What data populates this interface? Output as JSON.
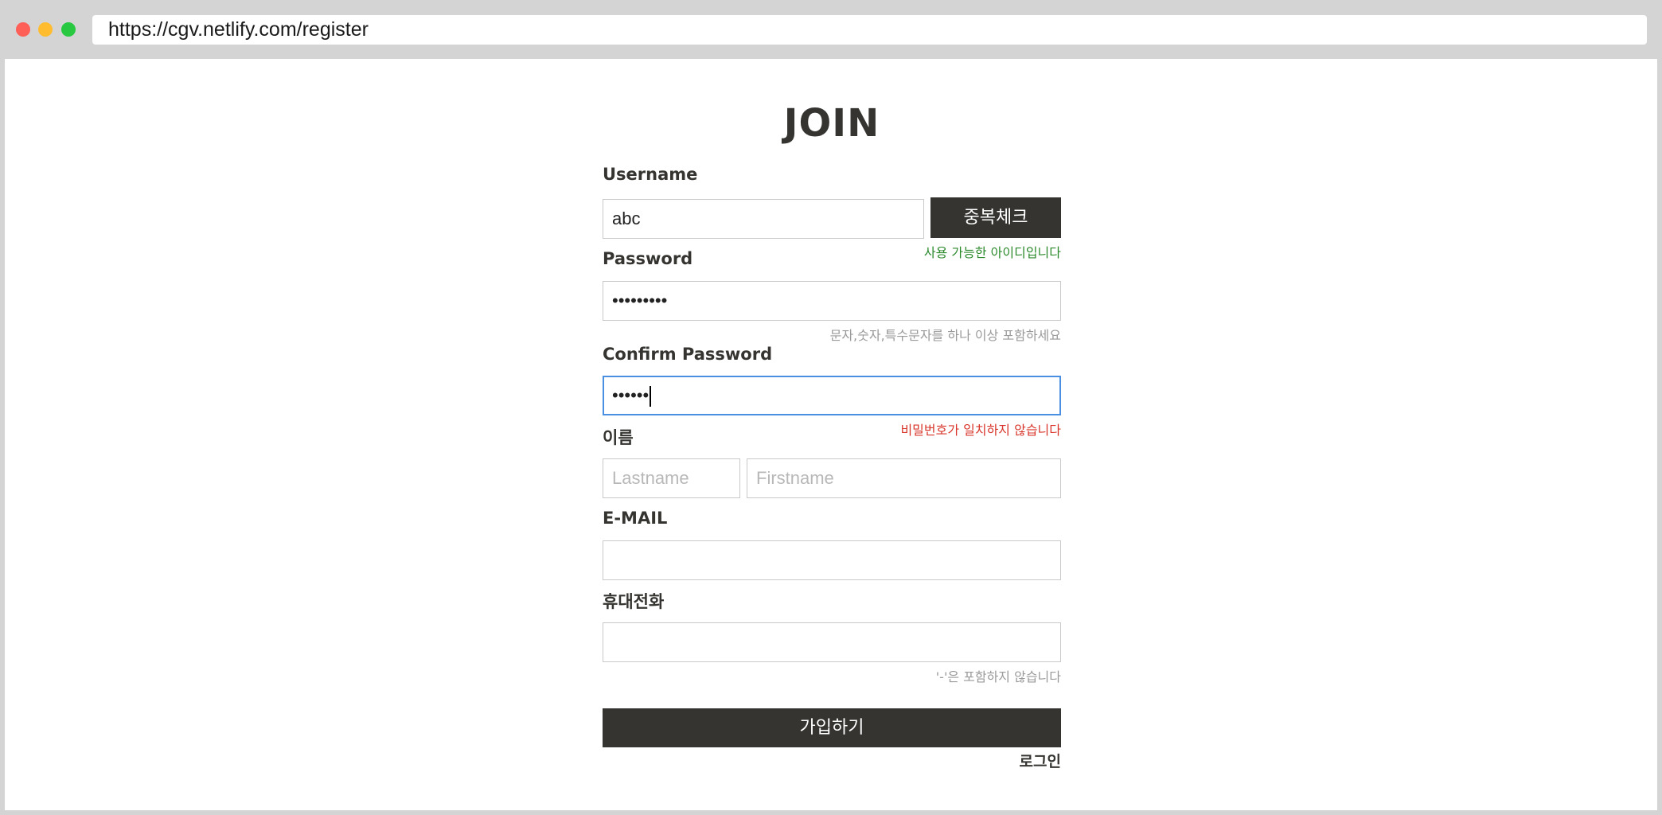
{
  "browser": {
    "url": "https://cgv.netlify.com/register"
  },
  "form": {
    "title": "JOIN",
    "username": {
      "label": "Username",
      "value": "abc",
      "check_button": "중복체크",
      "message": "사용 가능한 아이디입니다"
    },
    "password": {
      "label": "Password",
      "masked_value": "•••••••••",
      "hint": "문자,숫자,특수문자를 하나 이상 포함하세요"
    },
    "confirm_password": {
      "label": "Confirm Password",
      "masked_value": "••••••",
      "error": "비밀번호가 일치하지 않습니다"
    },
    "name": {
      "label": "이름",
      "lastname_placeholder": "Lastname",
      "firstname_placeholder": "Firstname"
    },
    "email": {
      "label": "E-MAIL",
      "value": ""
    },
    "phone": {
      "label": "휴대전화",
      "value": "",
      "hint": "'-'은 포함하지 않습니다"
    },
    "submit_label": "가입하기",
    "login_link": "로그인"
  },
  "colors": {
    "dark": "#353431",
    "success": "#2c8a2c",
    "error": "#d9362b",
    "focus": "#4a90e2"
  }
}
